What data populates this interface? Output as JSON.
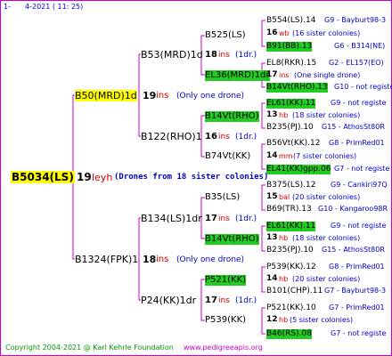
{
  "header": {
    "counter": "1-",
    "date": "4-2021 ( 11: 25)"
  },
  "footer": {
    "copyright": "Copyright 2004-2021 @ Karl Kehrle Foundation",
    "site": "www.pedigreeapis.org"
  },
  "colors": {
    "frame": "#cc00cc",
    "lines": "#cc00cc",
    "bee_red": "#cc0000",
    "note_blue": "#0000cc",
    "queen_box_yellow": "#ffff00",
    "queen_box_green": "#22cc22"
  },
  "root": {
    "queen": "B5034(LS)",
    "year": "19",
    "origin": "leyh",
    "note": "(Drones from 18 sister colonies)"
  },
  "gen1": [
    {
      "queen": "B50(MRD)1d",
      "year": "19",
      "abbr": "ins",
      "note": "(Only one drone)",
      "gen2": [
        {
          "queen": "B53(MRD)1d",
          "year": "18",
          "abbr": "ins",
          "note": "(1dr.)",
          "gen3": [
            {
              "queen": "B525(LS)"
            },
            {
              "queen": "EL36(MRD)1dr"
            }
          ]
        },
        {
          "queen": "B122(RHO)1",
          "year": "16",
          "abbr": "ins",
          "note": "(1dr.)",
          "gen3": [
            {
              "queen": "B14Vt(RHO)"
            },
            {
              "queen": "B74Vt(KK)"
            }
          ]
        }
      ]
    },
    {
      "queen": "B1324(FPK)1",
      "year": "18",
      "abbr": "ins",
      "note": "(Only one drone)",
      "gen2": [
        {
          "queen": "B134(LS)1dr",
          "year": "17",
          "abbr": "ins",
          "note": "(1dr.)",
          "gen3": [
            {
              "queen": "B35(LS)"
            },
            {
              "queen": "B14Vt(RHO)"
            }
          ]
        },
        {
          "queen": "P24(KK)1dr",
          "year": "17",
          "abbr": "ins",
          "note": "(1dr.)",
          "gen3": [
            {
              "queen": "P521(KK)"
            },
            {
              "queen": "P539(KK)"
            }
          ]
        }
      ]
    }
  ],
  "gen4": [
    {
      "top": "B554(LS).14",
      "top_id": "G9 - Bayburt98-3",
      "mid_year": "16",
      "mid_abbr": "wb",
      "mid_note": "(16 sister colonies)",
      "bot": "B91(BB).13",
      "bot_id": "G6 - B314(NE)"
    },
    {
      "top": "EL8(RKR).15",
      "top_id": "G2 - EL157(EO)",
      "mid_year": "17",
      "mid_abbr": "ins",
      "mid_note": "(One single drone)",
      "bot": "B14Vt(RHO).13",
      "bot_id": "G10 - not registe"
    },
    {
      "top": "EL61(KK).11",
      "top_id": "G9 - not registe",
      "mid_year": "13",
      "mid_abbr": "hb",
      "mid_note": "(18 sister colonies)",
      "bot": "B235(PJ).10",
      "bot_id": "G15 - AthosSt80R"
    },
    {
      "top": "B56Vt(KK).12",
      "top_id": "G8 - PrimRed01",
      "mid_year": "14",
      "mid_abbr": "mm",
      "mid_note": "(7 sister colonies)",
      "bot": "EL41(KK)gpp.06",
      "bot_id": "G7 - not registe"
    },
    {
      "top": "B375(LS).12",
      "top_id": "G9 - Cankiri97Q",
      "mid_year": "15",
      "mid_abbr": "bal",
      "mid_note": "(20 sister colonies)",
      "bot": "B69(TR).13",
      "bot_id": "G10 - Kangaroo98R"
    },
    {
      "top": "EL61(KK).11",
      "top_id": "G9 - not registe",
      "mid_year": "13",
      "mid_abbr": "hb",
      "mid_note": "(18 sister colonies)",
      "bot": "B235(PJ).10",
      "bot_id": "G15 - AthosSt80R"
    },
    {
      "top": "P539(KK).12",
      "top_id": "G8 - PrimRed01",
      "mid_year": "14",
      "mid_abbr": "hb",
      "mid_note": "(20 sister colonies)",
      "bot": "B101(CHP).11",
      "bot_id": "G7 - Bayburt98-3"
    },
    {
      "top": "P521(KK).10",
      "top_id": "G7 - PrimRed01",
      "mid_year": "12",
      "mid_abbr": "hb",
      "mid_note": "(5 sister colonies)",
      "bot": "B46(RS).08",
      "bot_id": "G7 - not registe"
    }
  ]
}
